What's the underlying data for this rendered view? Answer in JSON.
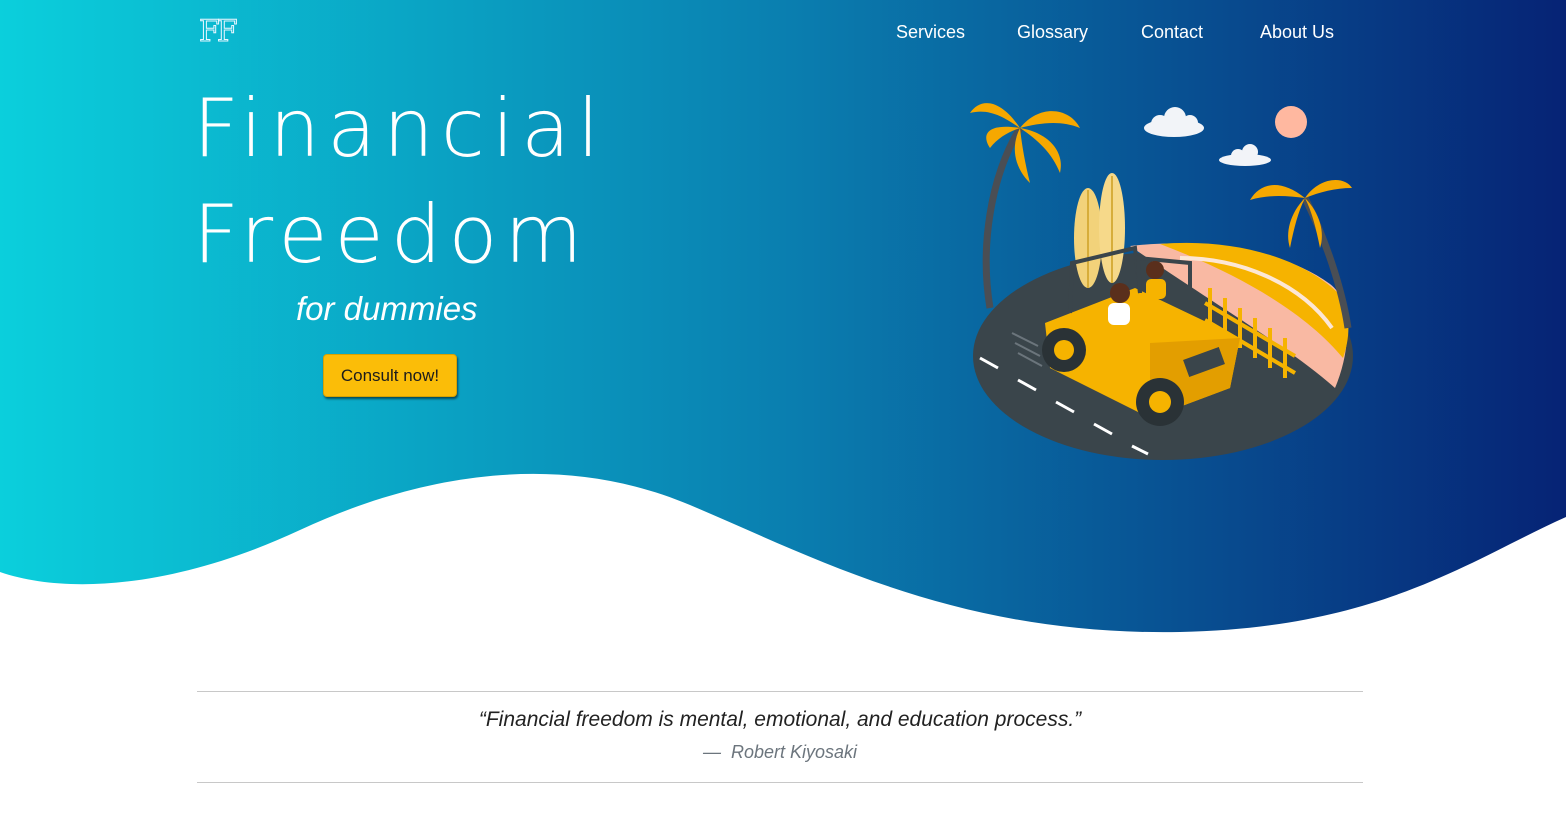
{
  "brand": {
    "logo_text": "FF"
  },
  "nav": {
    "items": [
      "Services",
      "Glossary",
      "Contact",
      "About Us"
    ]
  },
  "hero": {
    "title_line1": "Financial",
    "title_line2": "Freedom",
    "subtitle": "for dummies",
    "cta_label": "Consult now!",
    "gradient": {
      "start": "#0bcfdc",
      "end": "#062375"
    },
    "illustration_icon": "beach-jeep-illustration"
  },
  "quote": {
    "text": "“Financial freedom is mental, emotional, and education process.”",
    "author_dash": "—",
    "author": "Robert Kiyosaki"
  },
  "colors": {
    "accent": "#fbbd08",
    "text_muted": "#6c757d"
  }
}
